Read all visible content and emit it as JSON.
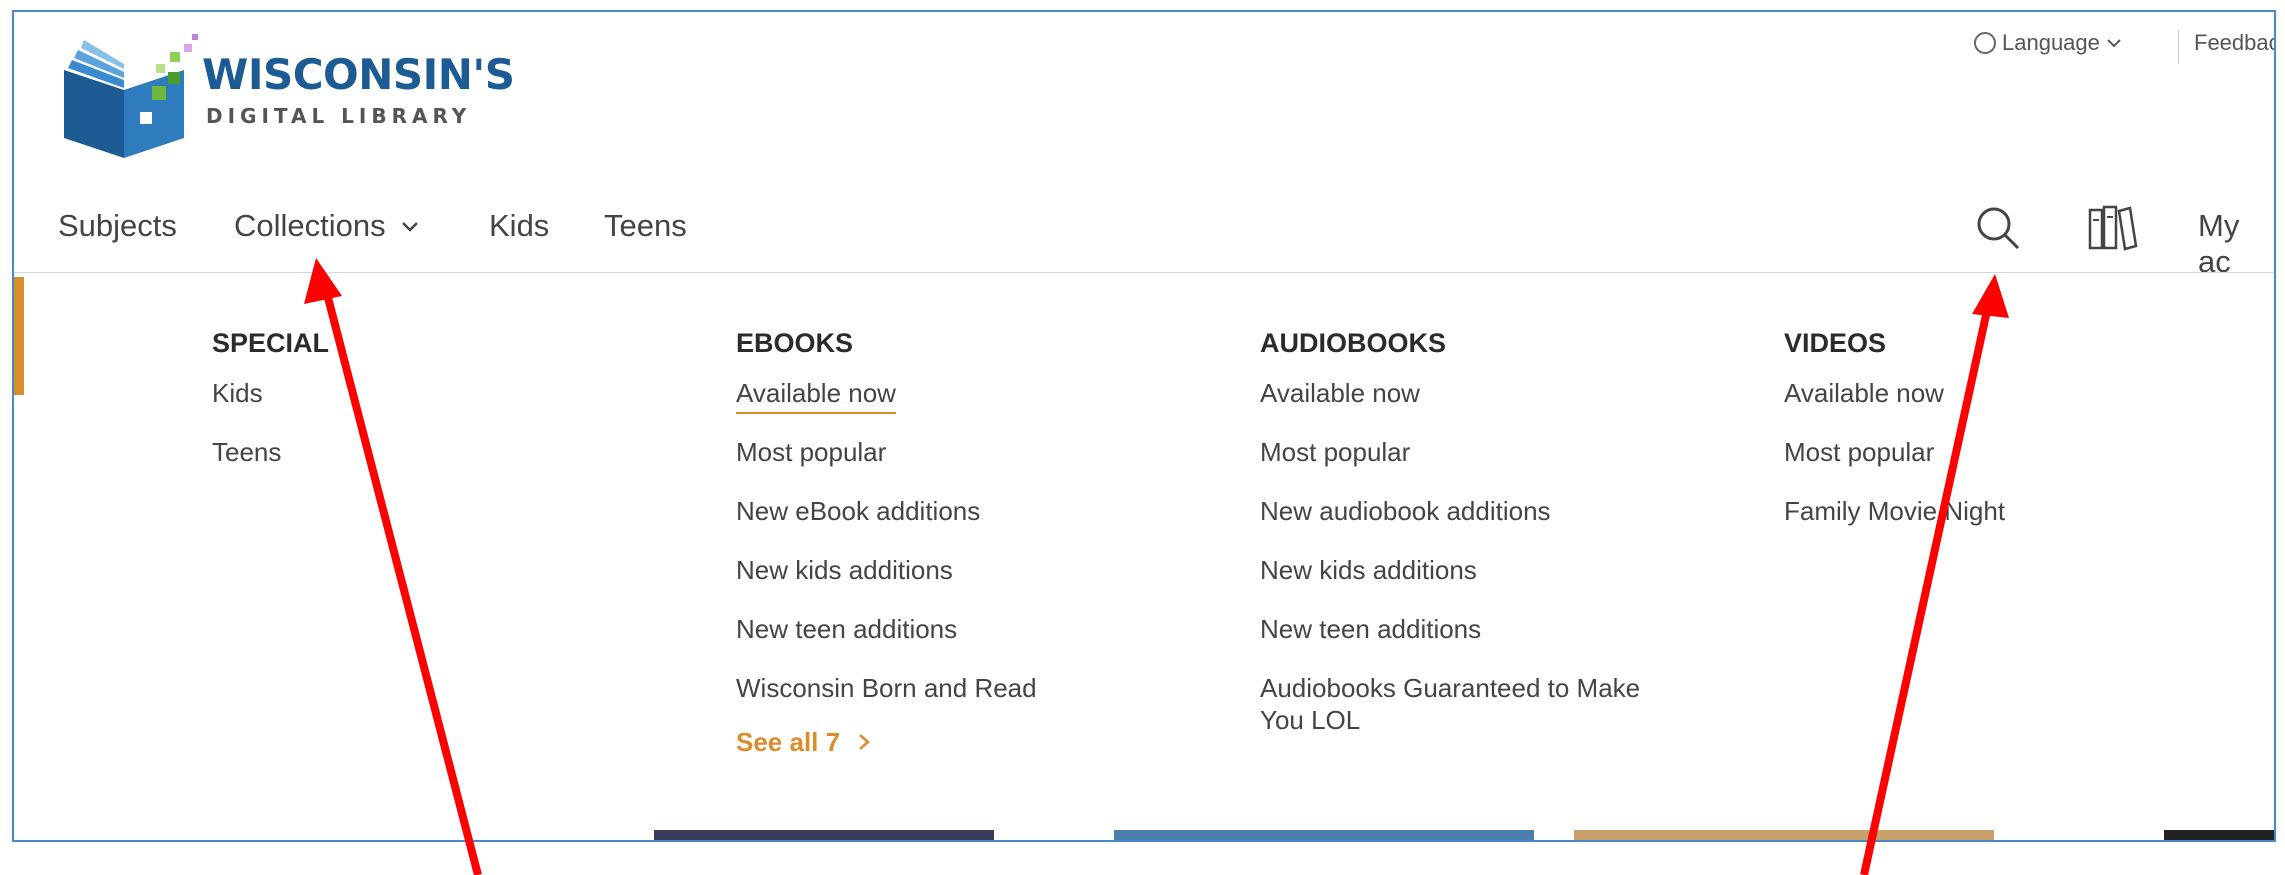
{
  "brand": {
    "title": "WISCONSIN'S",
    "subtitle": "DIGITAL LIBRARY"
  },
  "utility": {
    "language_label": "Language",
    "feedback_label": "Feedbac"
  },
  "nav": {
    "subjects": "Subjects",
    "collections": "Collections",
    "kids": "Kids",
    "teens": "Teens",
    "my_account": "My ac"
  },
  "menu": {
    "special": {
      "heading": "SPECIAL",
      "items": [
        "Kids",
        "Teens"
      ]
    },
    "ebooks": {
      "heading": "EBOOKS",
      "items": [
        "Available now",
        "Most popular",
        "New eBook additions",
        "New kids additions",
        "New teen additions",
        "Wisconsin Born and Read"
      ],
      "see_all": "See all 7"
    },
    "audiobooks": {
      "heading": "AUDIOBOOKS",
      "items": [
        "Available now",
        "Most popular",
        "New audiobook additions",
        "New kids additions",
        "New teen additions",
        "Audiobooks Guaranteed to Make You LOL"
      ]
    },
    "videos": {
      "heading": "VIDEOS",
      "items": [
        "Available now",
        "Most popular",
        "Family Movie Night"
      ]
    }
  },
  "colors": {
    "accent": "#d98d2b",
    "brand_blue": "#1d5b94",
    "annotation_red": "#ff0000",
    "frame_border": "#4a88c8"
  }
}
